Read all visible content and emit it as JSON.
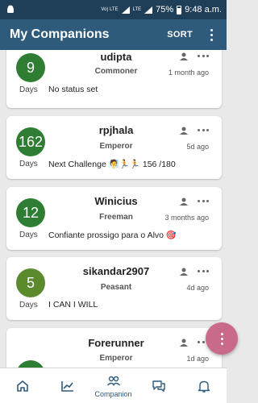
{
  "status_bar": {
    "network": "Vo) LTE",
    "network_2": "LTE",
    "battery": "75%",
    "time": "9:48 a.m."
  },
  "app_bar": {
    "title": "My Companions",
    "sort_label": "SORT"
  },
  "companions": [
    {
      "days": "9",
      "days_label": "Days",
      "name": "udipta",
      "rank": "Commoner",
      "time": "1 month ago",
      "status": "No status set"
    },
    {
      "days": "162",
      "days_label": "Days",
      "name": "rpjhala",
      "rank": "Emperor",
      "time": "5d ago",
      "status": "Next Challenge 🧖🏃🏃 156 /180"
    },
    {
      "days": "12",
      "days_label": "Days",
      "name": "Winicius",
      "rank": "Freeman",
      "time": "3 months ago",
      "status": "Confiante prossigo para o Alvo 🎯"
    },
    {
      "days": "5",
      "days_label": "Days",
      "name": "sikandar2907",
      "rank": "Peasant",
      "time": "4d ago",
      "status": "I CAN I WILL"
    },
    {
      "days": "",
      "days_label": "",
      "name": "Forerunner",
      "rank": "Emperor",
      "time": "1d ago",
      "status": ""
    }
  ],
  "bottom_nav": {
    "active_label": "Companion"
  },
  "colors": {
    "status_bar": "#1f3e58",
    "app_bar": "#2e5a7c",
    "badge_green": "#2e7d32",
    "badge_olive": "#5a8a2c",
    "fab": "#c96a8a"
  },
  "icons": [
    "android-icon",
    "signal-icon",
    "battery-icon",
    "person-icon",
    "more-horizontal-icon",
    "home-icon",
    "chart-line-icon",
    "companions-icon",
    "chat-icon",
    "bell-icon",
    "more-vertical-icon"
  ]
}
